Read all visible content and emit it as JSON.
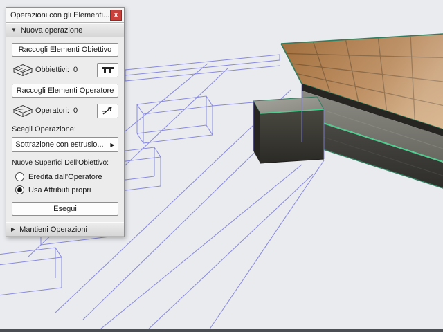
{
  "palette": {
    "title": "Operazioni con gli Elementi...",
    "sections": {
      "nuova": "Nuova operazione",
      "mantieni": "Mantieni Operazioni"
    },
    "buttons": {
      "collect_target": "Raccogli Elementi Obiettivo",
      "collect_operator": "Raccogli Elementi Operatore",
      "execute": "Esegui"
    },
    "counters": {
      "target_label": "Obbiettivi:",
      "target_value": "0",
      "operator_label": "Operatori:",
      "operator_value": "0"
    },
    "labels": {
      "choose_operation": "Scegli Operazione:",
      "new_surfaces": "Nuove Superfici Dell'Obiettivo:"
    },
    "dropdown": {
      "value": "Sottrazione con estrusio..."
    },
    "radios": [
      {
        "label": "Eredita dall'Operatore",
        "selected": false
      },
      {
        "label": "Usa Attributi propri",
        "selected": true
      }
    ]
  },
  "icons": {
    "close": "x",
    "expanded": "▼",
    "collapsed": "▶",
    "dropdown_arrow": "▶"
  },
  "colors": {
    "viewport_bg": "#e9ebee",
    "wireframe": "#7e7ee0",
    "tile": "#b5804d",
    "grout": "#7a5630",
    "concrete_mid": "#7d7c76",
    "concrete_dark": "#454440",
    "edge_green": "#4ad08e",
    "edge_teal": "#2f7d5e",
    "close_button": "#c9413c"
  }
}
